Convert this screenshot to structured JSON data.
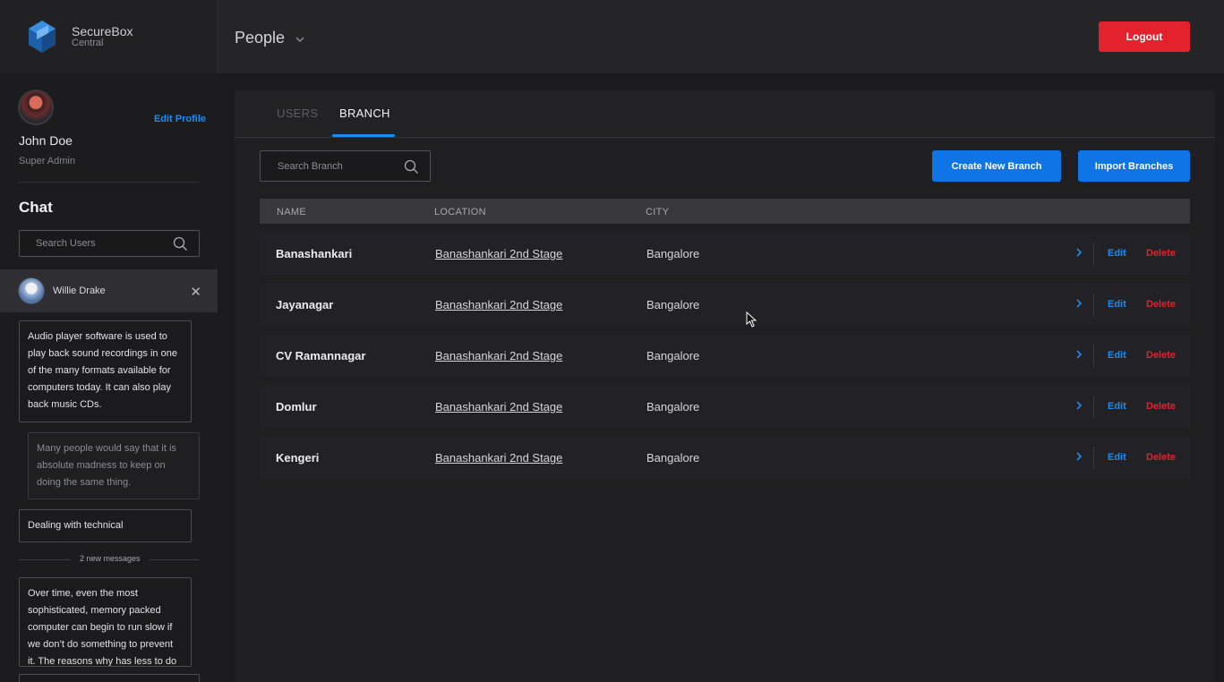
{
  "brand": {
    "name": "SecureBox",
    "sub": "Central"
  },
  "header": {
    "title": "People",
    "logout_label": "Logout"
  },
  "profile": {
    "name": "John Doe",
    "role": "Super Admin",
    "edit_label": "Edit Profile"
  },
  "chat": {
    "title": "Chat",
    "search_placeholder": "Search Users",
    "contact_name": "Willie Drake",
    "messages": [
      "Audio player software is used to play back sound recordings in one of the many formats available for computers today. It can also play back music CDs.",
      "Many people would say that it is absolute madness to keep on doing the same thing.",
      "Dealing with technical",
      "Over time, even the most sophisticated, memory packed computer can begin to run slow if we don’t do something to prevent it. The reasons why has less to do"
    ],
    "new_messages_label": "2 new messages"
  },
  "tabs": [
    {
      "label": "USERS"
    },
    {
      "label": "BRANCH"
    }
  ],
  "branch": {
    "search_placeholder": "Search Branch",
    "create_label": "Create New Branch",
    "import_label": "Import Branches",
    "columns": {
      "name": "NAME",
      "location": "LOCATION",
      "city": "CITY"
    },
    "actions": {
      "edit": "Edit",
      "delete": "Delete"
    },
    "rows": [
      {
        "name": "Banashankari",
        "location": "Banashankari 2nd Stage",
        "city": "Bangalore"
      },
      {
        "name": "Jayanagar",
        "location": "Banashankari 2nd Stage",
        "city": "Bangalore"
      },
      {
        "name": "CV Ramannagar",
        "location": "Banashankari 2nd Stage",
        "city": "Bangalore"
      },
      {
        "name": "Domlur",
        "location": "Banashankari 2nd Stage",
        "city": "Bangalore"
      },
      {
        "name": "Kengeri",
        "location": "Banashankari 2nd Stage",
        "city": "Bangalore"
      }
    ]
  },
  "colors": {
    "accent": "#1c8cf0",
    "danger": "#e3222e",
    "button_blue": "#0f74e6"
  },
  "icons": [
    "logo-icon",
    "chevron-down-icon",
    "search-icon",
    "close-icon",
    "chevron-right-icon",
    "cursor-icon"
  ]
}
